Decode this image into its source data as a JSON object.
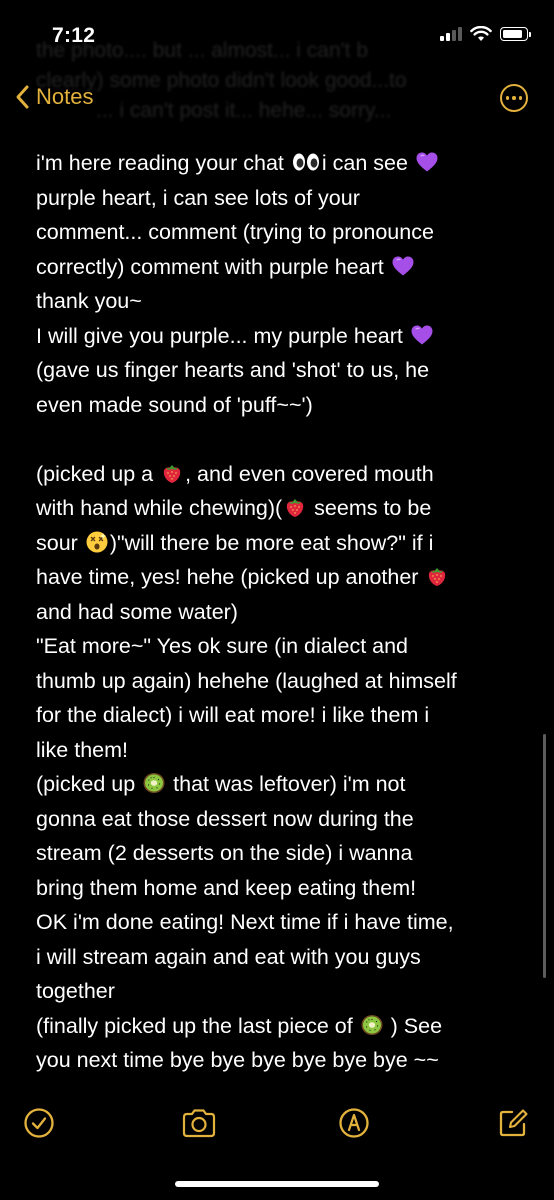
{
  "status_bar": {
    "time": "7:12"
  },
  "ghost_overlay": {
    "line1": "the photo.... but ... almost... i can't b",
    "line2": "clearly) some photo didn't look good...to",
    "line3": "... i can't post it... hehe... sorry..."
  },
  "nav": {
    "back_label": "Notes"
  },
  "note": {
    "lines": [
      [
        "i'm here reading your chat ",
        "{eyes}",
        "i can see ",
        "{heart}"
      ],
      [
        "purple heart, i can see lots of your"
      ],
      [
        "comment... comment (trying to pronounce"
      ],
      [
        "correctly) comment with purple heart ",
        "{heart}"
      ],
      [
        "thank you~"
      ],
      [
        "I will give you purple... my purple heart ",
        "{heart}"
      ],
      [
        "(gave us finger hearts and 'shot' to us, he"
      ],
      [
        "even made sound of 'puff~~')"
      ],
      [],
      [
        "(picked up a ",
        "{strawberry}",
        ", and even covered mouth"
      ],
      [
        "with hand while chewing)(",
        "{strawberry}",
        " seems to be"
      ],
      [
        "sour ",
        "{dizzy}",
        ")\"will there be more eat show?\" if i"
      ],
      [
        "have time, yes! hehe (picked up another ",
        "{strawberry}"
      ],
      [
        "and had some water)"
      ],
      [
        "\"Eat more~\" Yes ok sure (in dialect and"
      ],
      [
        "thumb up again) hehehe (laughed at himself"
      ],
      [
        "for the dialect) i will eat more! i like them i"
      ],
      [
        "like them!"
      ],
      [
        "(picked up ",
        "{kiwi}",
        " that was leftover) i'm not"
      ],
      [
        "gonna eat those dessert now during the"
      ],
      [
        "stream (2 desserts on the side) i wanna"
      ],
      [
        "bring them home and keep eating them!"
      ],
      [
        "OK i'm done eating! Next time if i have time,"
      ],
      [
        "i will stream again and eat with you guys"
      ],
      [
        "together"
      ],
      [
        "(finally picked up the last piece of ",
        "{kiwi}",
        " ) See"
      ],
      [
        "you next time bye bye bye bye bye bye ~~"
      ]
    ]
  },
  "icons": {
    "heart": "purple-heart-icon",
    "eyes": "eyes-icon",
    "strawberry": "strawberry-icon",
    "kiwi": "kiwi-icon",
    "dizzy": "dizzy-face-icon"
  },
  "toolbar": {
    "items": [
      "checklist-icon",
      "camera-icon",
      "markup-icon",
      "compose-icon"
    ]
  },
  "colors": {
    "accent": "#e3b23c",
    "background": "#000000",
    "text": "#ffffff",
    "purple_heart": "#a54ee8"
  },
  "battery_level": 0.9
}
